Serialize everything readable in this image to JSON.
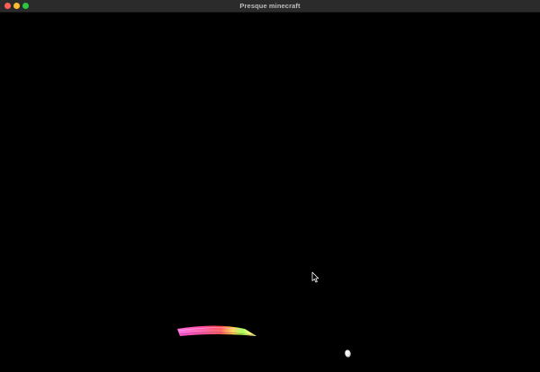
{
  "window": {
    "title": "Presque minecraft"
  },
  "colors": {
    "titlebar_bg": "#2b2b2b",
    "close": "#ff5f57",
    "minimize": "#febc2e",
    "zoom": "#28c840",
    "viewport_bg": "#000000"
  },
  "icons": {
    "close": "close-icon",
    "minimize": "minimize-icon",
    "zoom": "zoom-icon",
    "cursor": "mouse-pointer-icon"
  }
}
